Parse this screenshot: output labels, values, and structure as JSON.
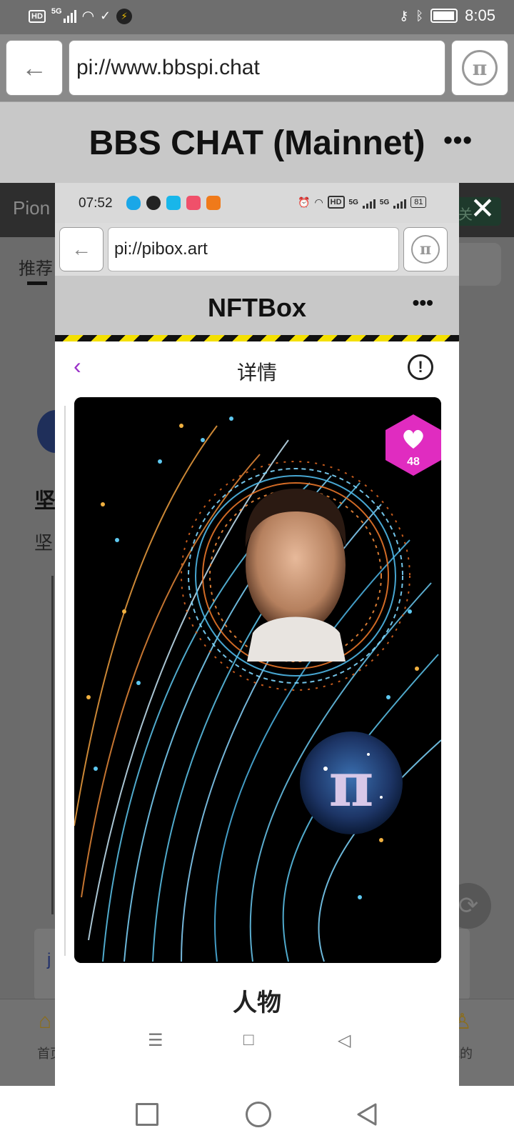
{
  "status_bar": {
    "time": "8:05",
    "network": "5G",
    "hd_label": "HD"
  },
  "outer_browser": {
    "url": "pi://www.bbspi.chat",
    "page_title": "BBS CHAT (Mainnet)",
    "more_label": "•••",
    "back_icon": "back-arrow-icon",
    "pi_icon": "pi-logo-icon"
  },
  "background_page": {
    "app_name": "Pion",
    "follow_label": "关",
    "tab_recommend": "推荐",
    "heading_fragment": "坚",
    "line_fragment": "坚",
    "card_fragment": "j",
    "nav_home_label": "首页",
    "nav_me_label": "我的"
  },
  "embedded_screenshot": {
    "status": {
      "time": "07:52",
      "hd_label": "HD",
      "net1": "5G",
      "net2": "5G",
      "battery": "81"
    },
    "browser": {
      "url": "pi://pibox.art",
      "page_title": "NFTBox",
      "more_label": "•••"
    },
    "detail_header": {
      "title": "详情",
      "back_icon": "chevron-left-icon",
      "info_label": "!"
    },
    "nft": {
      "like_count": "48",
      "category": "人物"
    },
    "system_nav": {
      "menu_icon": "☰",
      "home_icon": "□",
      "back_icon": "◁"
    }
  },
  "colors": {
    "accent_purple": "#9a30c8",
    "like_magenta": "#e02cc0",
    "hazard_yellow": "#f4e000"
  }
}
